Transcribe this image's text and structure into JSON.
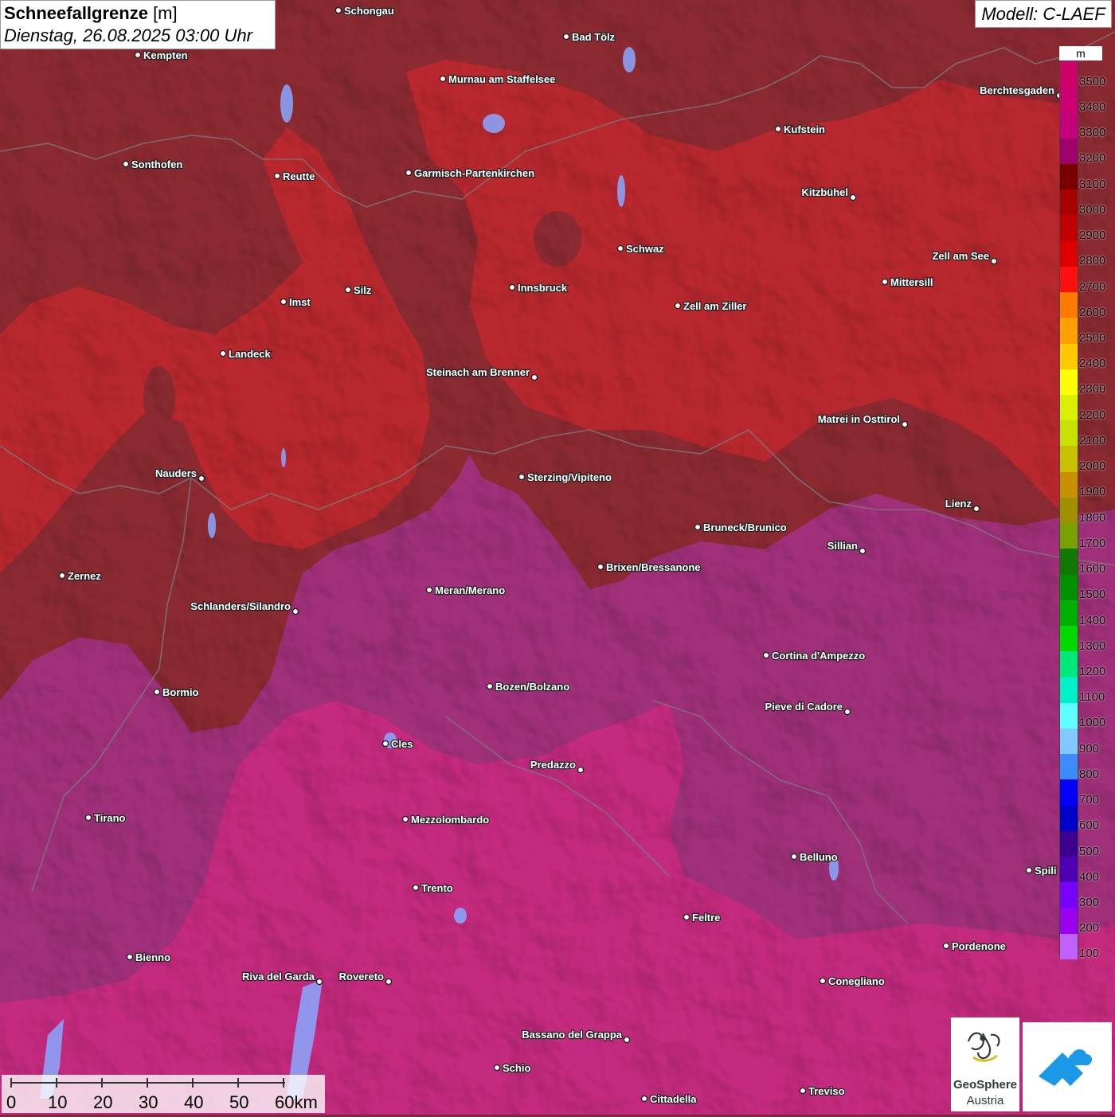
{
  "title": {
    "param_bold": "Schneefallgrenze",
    "param_unit": " [m]",
    "datetime": "Dienstag, 26.08.2025 03:00 Uhr"
  },
  "model": "Modell: C-LAEF",
  "legend": {
    "unit": "m",
    "levels": [
      3500,
      3400,
      3300,
      3200,
      3100,
      3000,
      2900,
      2800,
      2700,
      2600,
      2500,
      2400,
      2300,
      2200,
      2100,
      2000,
      1900,
      1800,
      1700,
      1600,
      1500,
      1400,
      1300,
      1200,
      1100,
      1000,
      900,
      800,
      700,
      600,
      500,
      400,
      300,
      200,
      100
    ],
    "colors": [
      "#d0006a",
      "#cc0070",
      "#c4007a",
      "#a0006a",
      "#7a0000",
      "#a80000",
      "#c00000",
      "#dc0000",
      "#ff1010",
      "#ff7a00",
      "#ffa000",
      "#ffc800",
      "#ffff00",
      "#d8f000",
      "#c8e000",
      "#c8c000",
      "#c89000",
      "#a09000",
      "#78a000",
      "#107800",
      "#009000",
      "#00b000",
      "#00d800",
      "#00e878",
      "#00f0c8",
      "#60ffff",
      "#80c8ff",
      "#3c8cff",
      "#0000ff",
      "#0000c8",
      "#3c0090",
      "#5000b4",
      "#7800ff",
      "#9c00f0",
      "#c060ff"
    ]
  },
  "cities": [
    {
      "name": "Schongau",
      "label_side": "right"
    },
    {
      "name": "Bad Tölz",
      "label_side": "right"
    },
    {
      "name": "Kempten",
      "label_side": "right"
    },
    {
      "name": "Murnau am Staffelsee",
      "label_side": "right"
    },
    {
      "name": "Berchtesgaden",
      "label_side": "left"
    },
    {
      "name": "Kufstein",
      "label_side": "right"
    },
    {
      "name": "Sonthofen",
      "label_side": "right"
    },
    {
      "name": "Reutte",
      "label_side": "right"
    },
    {
      "name": "Garmisch-Partenkirchen",
      "label_side": "right"
    },
    {
      "name": "Kitzbühel",
      "label_side": "left"
    },
    {
      "name": "Schwaz",
      "label_side": "right"
    },
    {
      "name": "Zell am See",
      "label_side": "left"
    },
    {
      "name": "Innsbruck",
      "label_side": "right"
    },
    {
      "name": "Mittersill",
      "label_side": "right"
    },
    {
      "name": "Imst",
      "label_side": "right"
    },
    {
      "name": "Silz",
      "label_side": "right"
    },
    {
      "name": "Zell am Ziller",
      "label_side": "right"
    },
    {
      "name": "Landeck",
      "label_side": "right"
    },
    {
      "name": "Steinach am Brenner",
      "label_side": "left"
    },
    {
      "name": "Matrei in Osttirol",
      "label_side": "left"
    },
    {
      "name": "Nauders",
      "label_side": "left"
    },
    {
      "name": "Sterzing/Vipiteno",
      "label_side": "right"
    },
    {
      "name": "Lienz",
      "label_side": "left"
    },
    {
      "name": "Bruneck/Brunico",
      "label_side": "right"
    },
    {
      "name": "Sillian",
      "label_side": "left"
    },
    {
      "name": "Zernez",
      "label_side": "right"
    },
    {
      "name": "Brixen/Bressanone",
      "label_side": "right"
    },
    {
      "name": "Meran/Merano",
      "label_side": "right"
    },
    {
      "name": "Schlanders/Silandro",
      "label_side": "left"
    },
    {
      "name": "Cortina d'Ampezzo",
      "label_side": "right"
    },
    {
      "name": "Bozen/Bolzano",
      "label_side": "right"
    },
    {
      "name": "Bormio",
      "label_side": "right"
    },
    {
      "name": "Pieve di Cadore",
      "label_side": "left"
    },
    {
      "name": "Cles",
      "label_side": "right"
    },
    {
      "name": "Predazzo",
      "label_side": "left"
    },
    {
      "name": "Tirano",
      "label_side": "right"
    },
    {
      "name": "Mezzolombardo",
      "label_side": "right"
    },
    {
      "name": "Belluno",
      "label_side": "right"
    },
    {
      "name": "Spili",
      "label_side": "right"
    },
    {
      "name": "Trento",
      "label_side": "right"
    },
    {
      "name": "Feltre",
      "label_side": "right"
    },
    {
      "name": "Pordenone",
      "label_side": "right"
    },
    {
      "name": "Bienno",
      "label_side": "right"
    },
    {
      "name": "Riva del Garda",
      "label_side": "left"
    },
    {
      "name": "Rovereto",
      "label_side": "left"
    },
    {
      "name": "Conegliano",
      "label_side": "right"
    },
    {
      "name": "Bassano del Grappa",
      "label_side": "left"
    },
    {
      "name": "Schio",
      "label_side": "right"
    },
    {
      "name": "Treviso",
      "label_side": "right"
    },
    {
      "name": "Cittadella",
      "label_side": "right"
    }
  ],
  "scale_bar": {
    "labels": [
      "0",
      "10",
      "20",
      "30",
      "40",
      "50",
      "60km"
    ]
  },
  "logo": {
    "line1": "GeoSphere",
    "line2": "Austria"
  }
}
